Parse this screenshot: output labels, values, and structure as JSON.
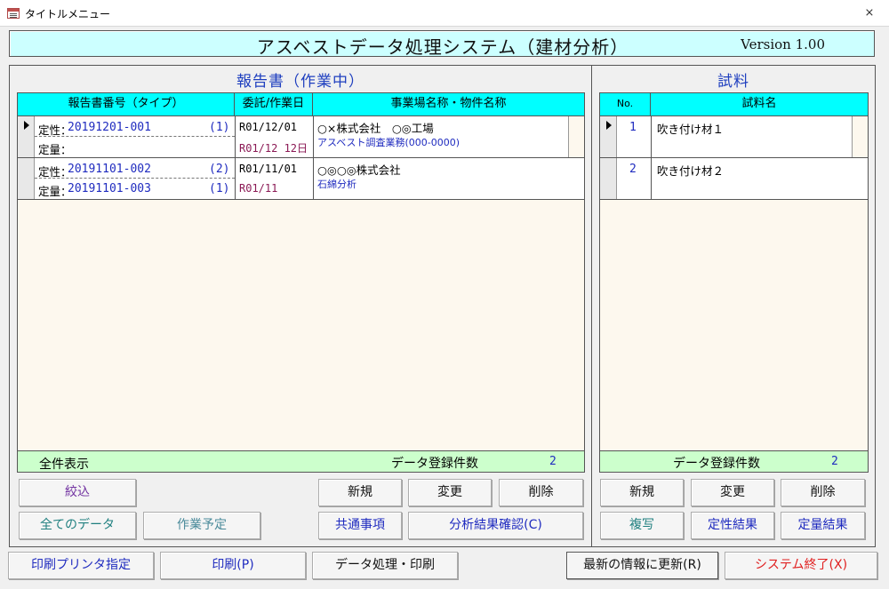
{
  "window": {
    "title": "タイトルメニュー"
  },
  "header": {
    "title": "アスベストデータ処理システム（建材分析）",
    "version": "Version 1.00"
  },
  "reports": {
    "caption": "報告書（作業中）",
    "columns": [
      "報告書番号（タイプ）",
      "委託/作業日",
      "事業場名称・物件名称"
    ],
    "rows": [
      {
        "qual_label": "定性：",
        "qual_no": "20191201-001",
        "qual_type": "(1)",
        "quant_label": "定量：",
        "quant_no": "",
        "quant_type": "",
        "consign_date": "R01/12/01",
        "work_date": "R01/12 12日",
        "company": "○×株式会社　○◎工場",
        "project": "アスベスト調査業務(000-0000)"
      },
      {
        "qual_label": "定性：",
        "qual_no": "20191101-002",
        "qual_type": "(2)",
        "quant_label": "定量：",
        "quant_no": "20191101-003",
        "quant_type": "(1)",
        "consign_date": "R01/11/01",
        "work_date": "R01/11",
        "company": "○◎○◎株式会社",
        "project": "石綿分析"
      }
    ],
    "footer": {
      "show_all": "全件表示",
      "count_label": "データ登録件数",
      "count": "2"
    },
    "buttons": {
      "filter": "絞込",
      "all_data": "全てのデータ",
      "schedule": "作業予定",
      "new": "新規",
      "edit": "変更",
      "delete": "削除",
      "common": "共通事項",
      "analysis": "分析結果確認(C)"
    }
  },
  "samples": {
    "caption": "試料",
    "columns": [
      "No.",
      "試料名"
    ],
    "rows": [
      {
        "no": "1",
        "name": "吹き付け材１"
      },
      {
        "no": "2",
        "name": "吹き付け材２"
      }
    ],
    "footer": {
      "count_label": "データ登録件数",
      "count": "2"
    },
    "buttons": {
      "new": "新規",
      "edit": "変更",
      "delete": "削除",
      "copy": "複写",
      "qual_result": "定性結果",
      "quant_result": "定量結果"
    }
  },
  "bottom": {
    "printer": "印刷プリンタ指定",
    "print": "印刷(P)",
    "data_print": "データ処理・印刷",
    "refresh": "最新の情報に更新(R)",
    "exit": "システム終了(X)"
  }
}
